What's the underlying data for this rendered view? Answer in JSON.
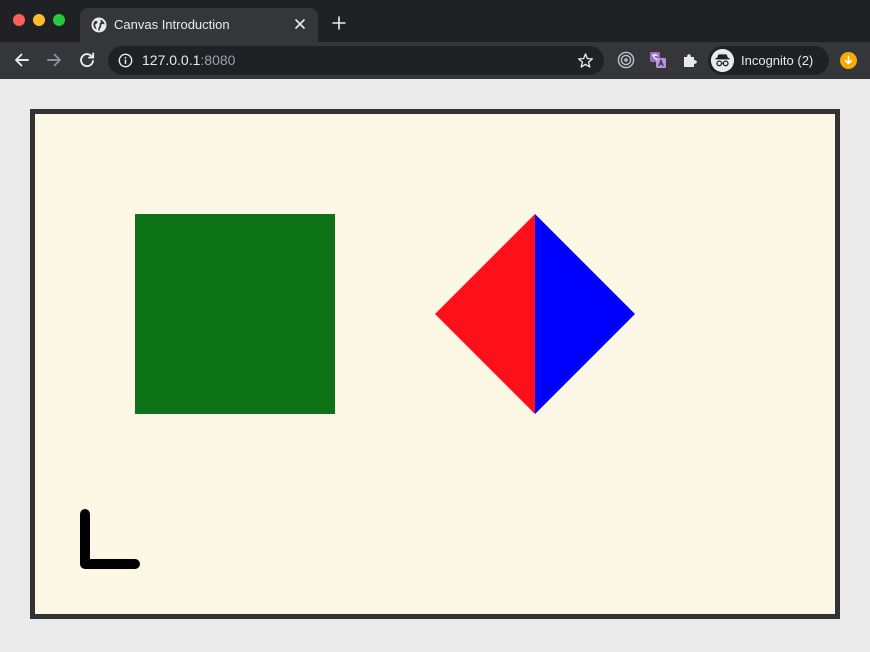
{
  "browser": {
    "tab": {
      "title": "Canvas Introduction"
    },
    "address": {
      "host": "127.0.0.1",
      "port": ":8080"
    },
    "profile": {
      "label": "Incognito (2)"
    },
    "colors": {
      "frame": "#202124",
      "toolbar": "#35363a",
      "traffic_close": "#ff5f57",
      "traffic_min": "#febc2e",
      "traffic_max": "#28c840",
      "update_badge": "#f9ab00"
    },
    "icons": {
      "tab": "globe-icon",
      "close": "close-icon",
      "new_tab": "plus-icon",
      "back": "arrow-left-icon",
      "forward": "arrow-right-icon",
      "reload": "reload-icon",
      "site_info": "info-icon",
      "bookmark": "star-icon",
      "extensions": [
        "radar-icon",
        "translate-icon",
        "puzzle-icon"
      ],
      "profile": "incognito-icon",
      "update": "update-icon"
    }
  },
  "canvas": {
    "background": "#fdf7e6",
    "border_color": "#333333",
    "shapes": [
      {
        "kind": "square",
        "fill": "#0d7316"
      },
      {
        "kind": "diamond-left-half",
        "fill": "#ff1018"
      },
      {
        "kind": "diamond-right-half",
        "fill": "#0000ff"
      },
      {
        "kind": "l-stroke",
        "stroke": "#000000"
      }
    ]
  }
}
